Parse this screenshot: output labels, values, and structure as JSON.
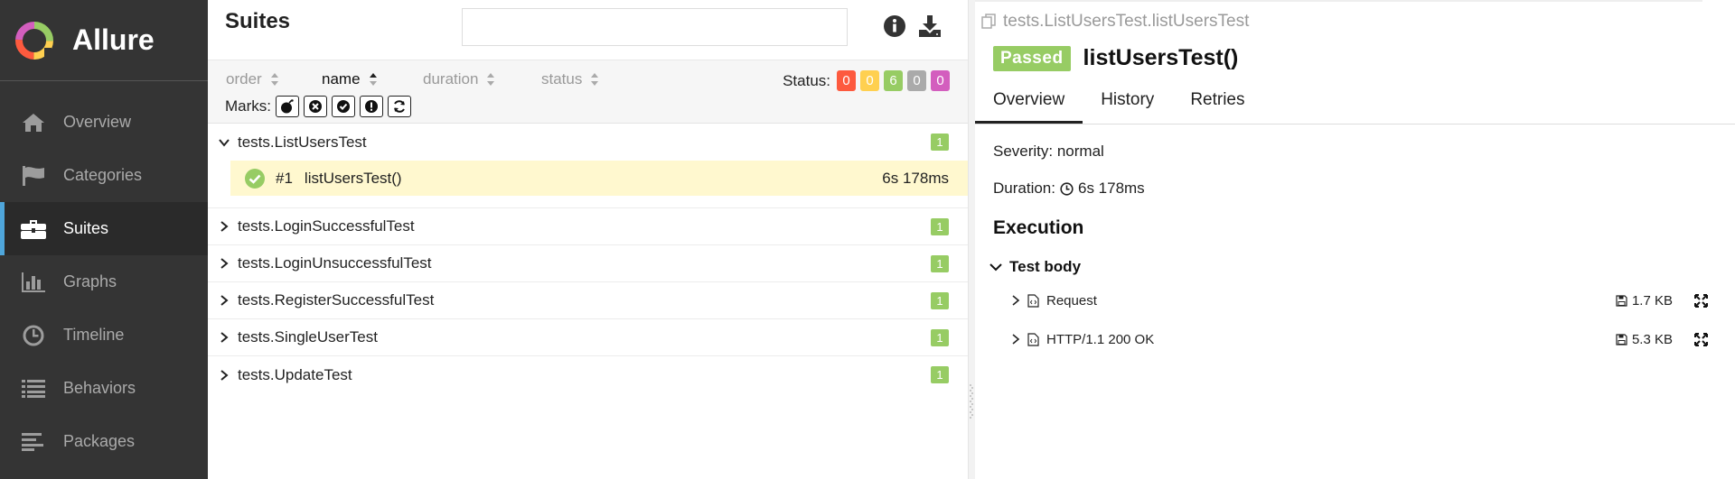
{
  "brand": {
    "name": "Allure"
  },
  "sidebar": {
    "items": [
      {
        "label": "Overview",
        "icon": "home-icon"
      },
      {
        "label": "Categories",
        "icon": "flag-icon"
      },
      {
        "label": "Suites",
        "icon": "briefcase-icon",
        "active": true
      },
      {
        "label": "Graphs",
        "icon": "bar-chart-icon"
      },
      {
        "label": "Timeline",
        "icon": "clock-icon"
      },
      {
        "label": "Behaviors",
        "icon": "list-icon"
      },
      {
        "label": "Packages",
        "icon": "align-left-icon"
      }
    ]
  },
  "suites": {
    "title": "Suites",
    "search_value": "",
    "sort": {
      "order": "order",
      "name": "name",
      "duration": "duration",
      "status": "status"
    },
    "status_label": "Status:",
    "status_counts": [
      {
        "value": "0",
        "color": "#fd5a3e"
      },
      {
        "value": "0",
        "color": "#ffd050"
      },
      {
        "value": "6",
        "color": "#97cc64"
      },
      {
        "value": "0",
        "color": "#aaaaaa"
      },
      {
        "value": "0",
        "color": "#d35ebe"
      }
    ],
    "marks_label": "Marks:",
    "marks": [
      "bomb-icon",
      "close-circle-icon",
      "check-circle-icon",
      "exclamation-circle-icon",
      "retry-icon"
    ],
    "groups": [
      {
        "name": "tests.ListUsersTest",
        "count": "1",
        "expanded": true
      },
      {
        "name": "tests.LoginSuccessfulTest",
        "count": "1"
      },
      {
        "name": "tests.LoginUnsuccessfulTest",
        "count": "1"
      },
      {
        "name": "tests.RegisterSuccessfulTest",
        "count": "1"
      },
      {
        "name": "tests.SingleUserTest",
        "count": "1"
      },
      {
        "name": "tests.UpdateTest",
        "count": "1"
      }
    ],
    "selected_test": {
      "num": "#1",
      "name": "listUsersTest()",
      "duration": "6s 178ms"
    }
  },
  "detail": {
    "breadcrumb": "tests.ListUsersTest.listUsersTest",
    "status": "Passed",
    "title": "listUsersTest()",
    "tabs": [
      "Overview",
      "History",
      "Retries"
    ],
    "severity": "Severity: normal",
    "duration_label": "Duration:",
    "duration_value": "6s 178ms",
    "section": "Execution",
    "test_body": "Test body",
    "steps": [
      {
        "name": "Request",
        "size": "1.7 KB"
      },
      {
        "name": "HTTP/1.1 200 OK",
        "size": "5.3 KB"
      }
    ]
  }
}
